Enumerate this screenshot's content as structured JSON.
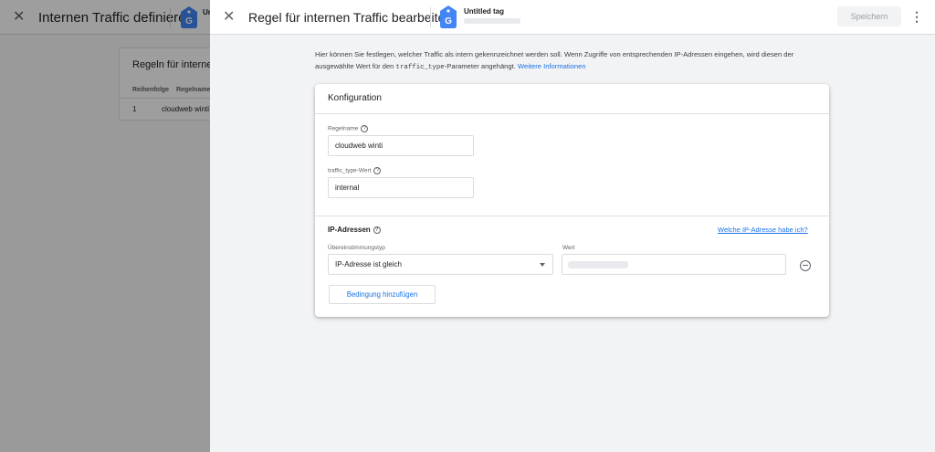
{
  "background": {
    "title": "Internen Traffic definieren",
    "tag_name": "Ur",
    "card_title": "Regeln für internen T",
    "columns": [
      "Reihenfolge",
      "Regelname"
    ],
    "rows": [
      {
        "order": "1",
        "name": "cloudweb winti"
      }
    ]
  },
  "panel": {
    "title": "Regel für internen Traffic bearbeiten",
    "tag_name": "Untitled tag",
    "tag_letter": "G",
    "save_label": "Speichern",
    "more_icon": "⋮",
    "close_icon": "✕",
    "intro_part1": "Hier können Sie festlegen, welcher Traffic als intern gekennzeichnet werden soll. Wenn Zugriffe von entsprechenden IP-Adressen eingehen, wird diesen der ausgewählte Wert für den ",
    "intro_code": "traffic_type",
    "intro_part2": "-Parameter angehängt. ",
    "intro_link": "Weitere Informationen"
  },
  "config": {
    "title": "Konfiguration",
    "rule_name_label": "Regelname",
    "rule_name_value": "cloudweb winti",
    "traffic_type_label": "traffic_type-Wert",
    "traffic_type_value": "internal",
    "ip_title": "IP-Adressen",
    "ip_link": "Welche IP-Adresse habe ich?",
    "match_type_label": "Übereinstimmungstyp",
    "match_type_value": "IP-Adresse ist gleich",
    "value_label": "Wert",
    "add_condition_label": "Bedingung hinzufügen",
    "help_glyph": "?"
  },
  "colors": {
    "accent": "#1a73e8",
    "tag_blue": "#4285f4"
  }
}
